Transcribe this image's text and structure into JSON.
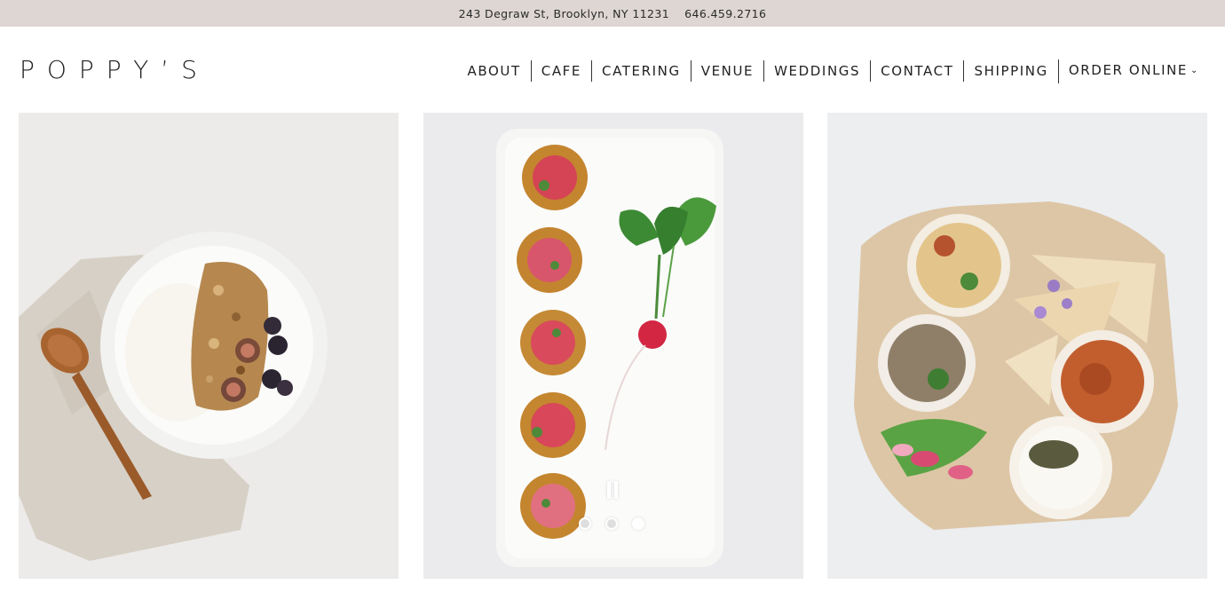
{
  "topbar": {
    "address": "243 Degraw St, Brooklyn, NY 11231",
    "phone": "646.459.2716"
  },
  "header": {
    "logo": "POPPY’S"
  },
  "nav": {
    "items": [
      {
        "label": "ABOUT"
      },
      {
        "label": "CAFE"
      },
      {
        "label": "CATERING"
      },
      {
        "label": "VENUE"
      },
      {
        "label": "WEDDINGS"
      },
      {
        "label": "CONTACT"
      },
      {
        "label": "SHIPPING"
      },
      {
        "label": "ORDER ONLINE",
        "icon": "chevron-down-icon"
      }
    ]
  },
  "gallery": {
    "images": [
      {
        "name": "granola-bowl-photo"
      },
      {
        "name": "radish-platter-photo"
      },
      {
        "name": "mezze-platter-photo"
      }
    ],
    "slide_count": 3,
    "active_slide": 3,
    "controls": {
      "pause_icon": "pause-icon"
    }
  },
  "colors": {
    "topbar_bg": "#ddd6d2",
    "text": "#222222"
  }
}
